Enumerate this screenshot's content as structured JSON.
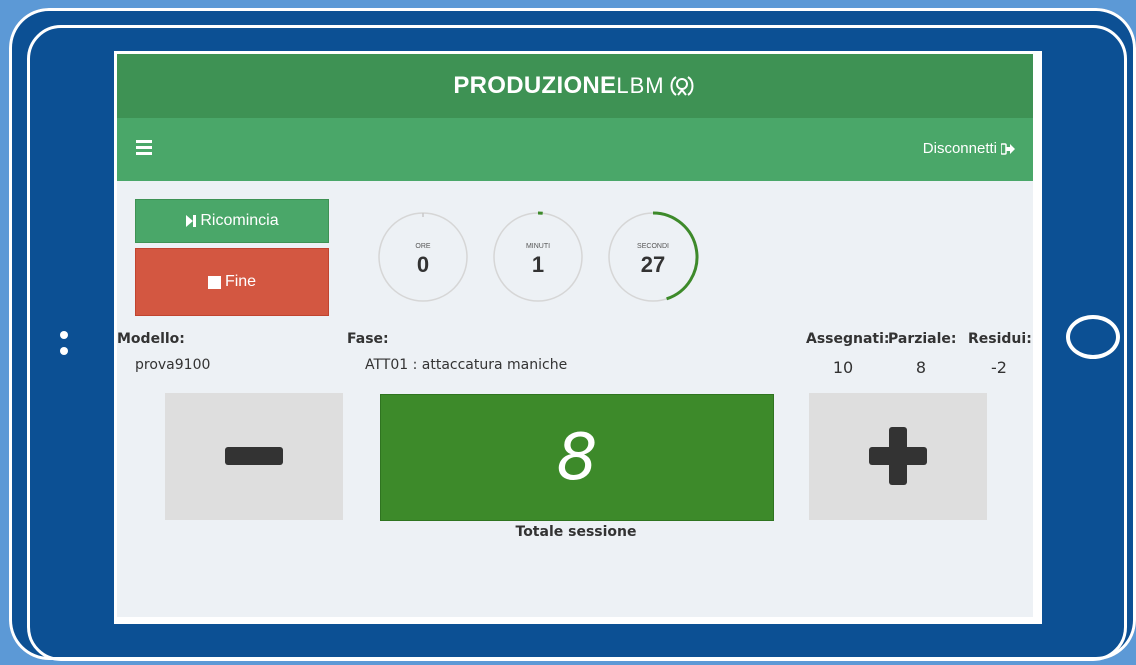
{
  "app": {
    "brand_bold": "PRODUZIONE",
    "brand_thin": "LBM"
  },
  "navbar": {
    "logout_label": "Disconnetti"
  },
  "actions": {
    "restart_label": "Ricomincia",
    "end_label": "Fine"
  },
  "timers": {
    "hours": {
      "label": "ORE",
      "value": "0",
      "progress": 0.0
    },
    "minutes": {
      "label": "MINUTI",
      "value": "1",
      "progress": 0.017
    },
    "seconds": {
      "label": "SECONDI",
      "value": "27",
      "progress": 0.45
    }
  },
  "info": {
    "model_label": "Modello:",
    "model_value": "prova9100",
    "phase_label": "Fase:",
    "phase_value": "ATT01 : attaccatura maniche",
    "assigned_label": "Assegnati:",
    "assigned_value": "10",
    "partial_label": "Parziale:",
    "partial_value": "8",
    "remaining_label": "Residui:",
    "remaining_value": "-2"
  },
  "counter": {
    "value": "8",
    "label": "Totale sessione"
  },
  "colors": {
    "header": "#3e9254",
    "navbar": "#4aa769",
    "end_button": "#d35741",
    "counter_bg": "#3d8a2a",
    "tablet": "#0c5094"
  }
}
